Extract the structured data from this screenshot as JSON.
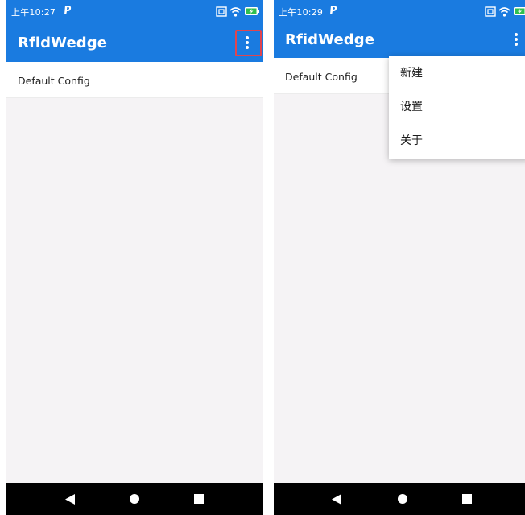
{
  "colors": {
    "primary": "#1a7be0",
    "background": "#f5f3f5",
    "highlight": "#e0454f",
    "navbar": "#000000"
  },
  "screens": [
    {
      "status_time": "上午10:27",
      "app_title": "RfidWedge",
      "list_items": [
        "Default Config"
      ]
    },
    {
      "status_time": "上午10:29",
      "app_title": "RfidWedge",
      "list_items": [
        "Default Config"
      ],
      "overflow_menu": [
        "新建",
        "设置",
        "关于"
      ]
    }
  ],
  "icons": {
    "status": [
      "parking-icon",
      "sim-icon",
      "wifi-icon",
      "battery-charging-icon"
    ],
    "appbar": "more-vert-icon",
    "navigation": [
      "back-icon",
      "home-icon",
      "recents-icon"
    ]
  }
}
